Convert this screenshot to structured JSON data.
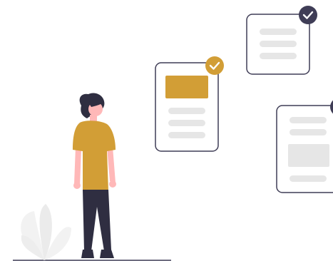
{
  "illustration": {
    "colors": {
      "accent": "#D29E36",
      "dark": "#2F2E41",
      "skin": "#FFB8B8",
      "line_gray": "#E6E6E6",
      "placeholder_gray": "#E6E6E6",
      "card_border": "#3F3D56",
      "plant": "#F2F2F2"
    },
    "cards": [
      {
        "name": "middle-card",
        "status": "checked",
        "check_color": "#D29E36",
        "has_accent_block": true
      },
      {
        "name": "top-right-card",
        "status": "checked",
        "check_color": "#3F3D56",
        "has_accent_block": false
      },
      {
        "name": "right-card",
        "status": "partially-visible",
        "check_color": "#3F3D56",
        "has_accent_block": false
      }
    ],
    "icons": [
      "checkmark-icon",
      "checkmark-icon",
      "person-figure",
      "plant"
    ]
  }
}
